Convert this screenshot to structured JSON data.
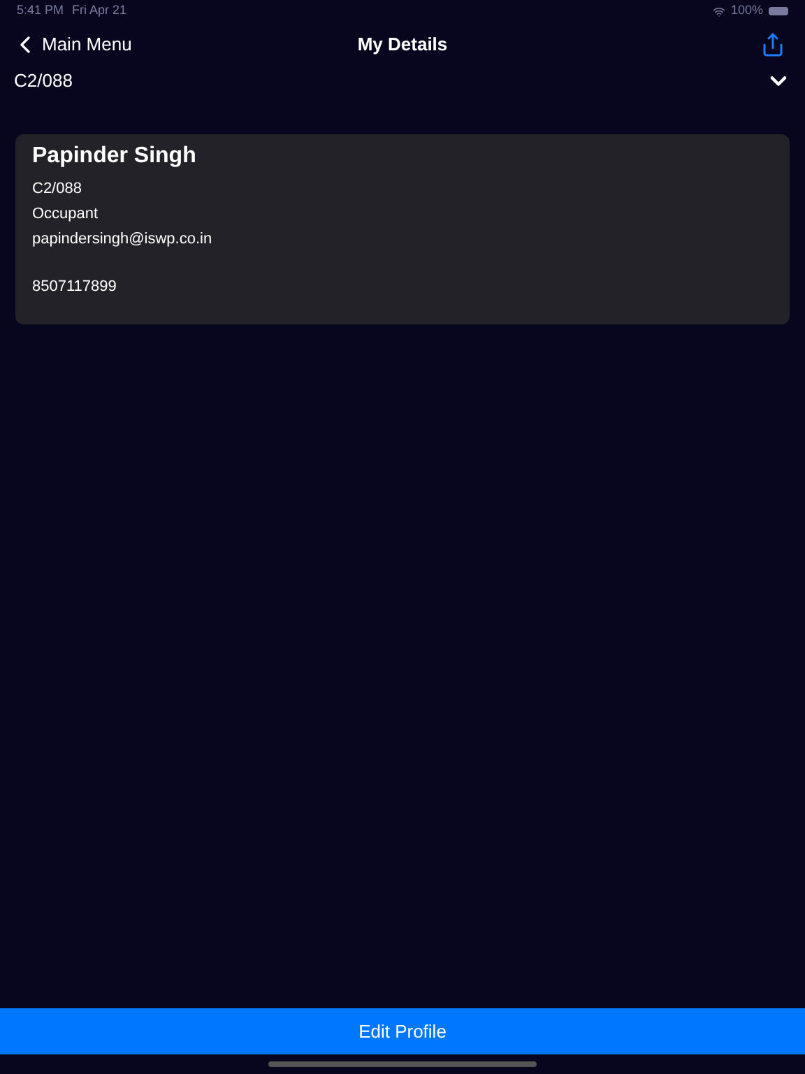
{
  "status_bar": {
    "time": "5:41 PM",
    "date": "Fri Apr 21",
    "battery": "100%"
  },
  "nav": {
    "back": "Main Menu",
    "title": "My Details"
  },
  "unit_selector": {
    "value": "C2/088"
  },
  "profile": {
    "name": "Papinder Singh",
    "lines": [
      "C2/088",
      "Occupant",
      "papindersingh@iswp.co.in"
    ],
    "phone": "8507117899"
  },
  "edit_button": "Edit Profile"
}
